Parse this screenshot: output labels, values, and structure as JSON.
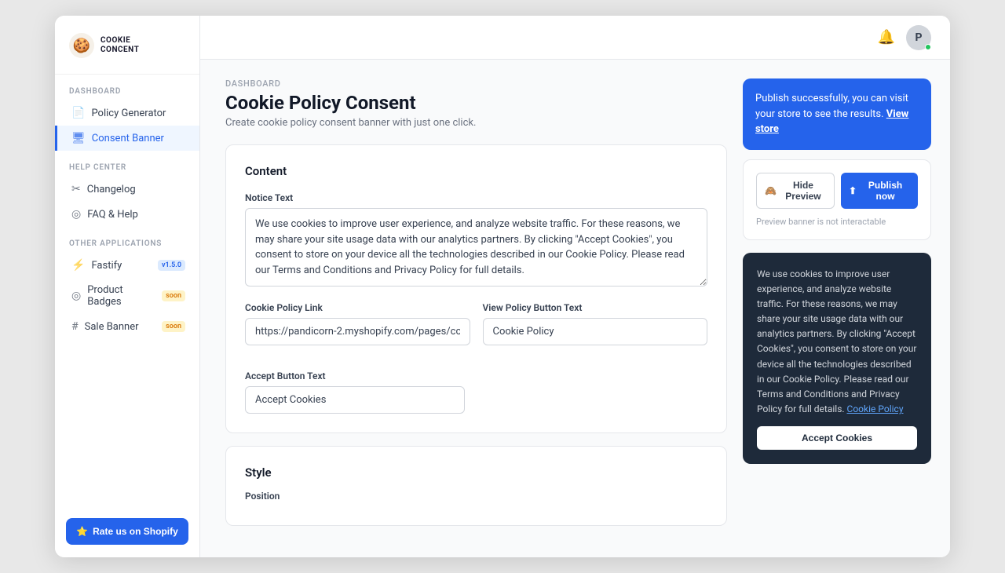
{
  "window": {
    "title": "Cookie Concent"
  },
  "sidebar": {
    "logo": {
      "icon": "🍪",
      "name_line1": "COOKIE",
      "name_line2": "CONCENT"
    },
    "sections": [
      {
        "label": "Dashboard",
        "items": [
          {
            "id": "policy-generator",
            "label": "Policy Generator",
            "icon": "📄",
            "active": false
          },
          {
            "id": "consent-banner",
            "label": "Consent Banner",
            "icon": "🖥",
            "active": true
          }
        ]
      },
      {
        "label": "Help Center",
        "items": [
          {
            "id": "changelog",
            "label": "Changelog",
            "icon": "✂️",
            "active": false
          },
          {
            "id": "faq-help",
            "label": "FAQ & Help",
            "icon": "⊙",
            "active": false
          }
        ]
      },
      {
        "label": "Other Applications",
        "items": [
          {
            "id": "fastify",
            "label": "Fastify",
            "icon": "⚡",
            "badge": "v1.5.0",
            "badge_type": "version",
            "active": false
          },
          {
            "id": "product-badges",
            "label": "Product Badges",
            "icon": "⊙",
            "badge": "soon",
            "badge_type": "soon",
            "active": false
          },
          {
            "id": "sale-banner",
            "label": "Sale Banner",
            "icon": "#",
            "badge": "soon",
            "badge_type": "soon",
            "active": false
          }
        ]
      }
    ],
    "rate_button": "Rate us on Shopify"
  },
  "topbar": {
    "notification_icon": "🔔",
    "avatar_letter": "P"
  },
  "page": {
    "breadcrumb": "Dashboard",
    "title": "Cookie Policy Consent",
    "subtitle": "Create cookie policy consent banner with just one click."
  },
  "content": {
    "card_title": "Content",
    "notice_text_label": "Notice Text",
    "notice_text_value": "We use cookies to improve user experience, and analyze website traffic. For these reasons, we may share your site usage data with our analytics partners. By clicking \"Accept Cookies\", you consent to store on your device all the technologies described in our Cookie Policy. Please read our Terms and Conditions and Privacy Policy for full details.",
    "cookie_policy_link_label": "Cookie Policy Link",
    "cookie_policy_link_value": "https://pandicorn-2.myshopify.com/pages/cc",
    "view_policy_button_label": "View Policy Button Text",
    "view_policy_button_value": "Cookie Policy",
    "accept_button_label": "Accept Button Text",
    "accept_button_value": "Accept Cookies"
  },
  "style": {
    "card_title": "Style",
    "position_label": "Position"
  },
  "right_panel": {
    "publish_banner": {
      "text": "Publish successfully, you can visit your store to see the results.",
      "link_text": "View store"
    },
    "hide_preview_label": "Hide Preview",
    "publish_now_label": "Publish now",
    "preview_note": "Preview banner is not interactable"
  },
  "cookie_preview": {
    "text": "We use cookies to improve user experience, and analyze website traffic. For these reasons, we may share your site usage data with our analytics partners. By clicking \"Accept Cookies\", you consent to store on your device all the technologies described in our Cookie Policy. Please read our Terms and Conditions and Privacy Policy for full details.",
    "policy_link": "Cookie Policy",
    "accept_button": "Accept Cookies"
  }
}
